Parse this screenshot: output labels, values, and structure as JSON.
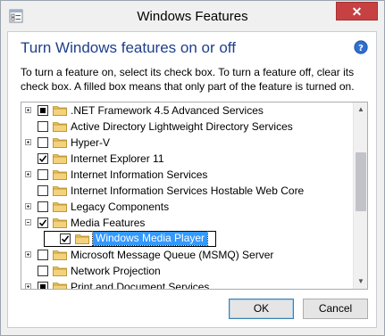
{
  "window": {
    "title": "Windows Features",
    "close_label": "✕"
  },
  "content": {
    "heading": "Turn Windows features on or off",
    "description": "To turn a feature on, select its check box. To turn a feature off, clear its check box. A filled box means that only part of the feature is turned on."
  },
  "features": [
    {
      "label": ".NET Framework 4.5 Advanced Services",
      "state": "partial",
      "expander": "plus",
      "indent": 0
    },
    {
      "label": "Active Directory Lightweight Directory Services",
      "state": "unchecked",
      "expander": "none",
      "indent": 0
    },
    {
      "label": "Hyper-V",
      "state": "unchecked",
      "expander": "plus",
      "indent": 0
    },
    {
      "label": "Internet Explorer 11",
      "state": "checked",
      "expander": "none",
      "indent": 0
    },
    {
      "label": "Internet Information Services",
      "state": "unchecked",
      "expander": "plus",
      "indent": 0
    },
    {
      "label": "Internet Information Services Hostable Web Core",
      "state": "unchecked",
      "expander": "none",
      "indent": 0
    },
    {
      "label": "Legacy Components",
      "state": "unchecked",
      "expander": "plus",
      "indent": 0
    },
    {
      "label": "Media Features",
      "state": "checked",
      "expander": "minus",
      "indent": 0
    },
    {
      "label": "Windows Media Player",
      "state": "checked",
      "expander": "none",
      "indent": 1,
      "selected": true
    },
    {
      "label": "Microsoft Message Queue (MSMQ) Server",
      "state": "unchecked",
      "expander": "plus",
      "indent": 0
    },
    {
      "label": "Network Projection",
      "state": "unchecked",
      "expander": "none",
      "indent": 0
    },
    {
      "label": "Print and Document Services",
      "state": "partial",
      "expander": "plus",
      "indent": 0
    }
  ],
  "buttons": {
    "ok": "OK",
    "cancel": "Cancel"
  },
  "icons": {
    "app": "windows-features-icon",
    "help": "help-icon",
    "folder": "folder-icon"
  },
  "colors": {
    "heading": "#1e3f8c",
    "selection": "#3399ff",
    "close_button": "#c74143",
    "folder": "#e8c25a"
  }
}
